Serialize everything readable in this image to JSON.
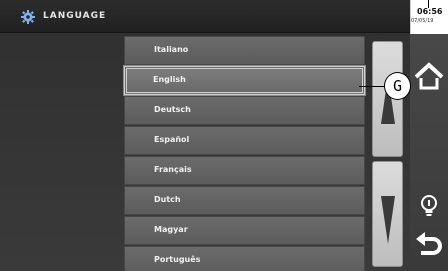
{
  "header": {
    "title": "LANGUAGE"
  },
  "languages": [
    {
      "label": "Italiano"
    },
    {
      "label": "English"
    },
    {
      "label": "Deutsch"
    },
    {
      "label": "Español"
    },
    {
      "label": "Français"
    },
    {
      "label": "Dutch"
    },
    {
      "label": "Magyar"
    },
    {
      "label": "Português"
    }
  ],
  "selected_language": "English",
  "clock": {
    "time": "06:56",
    "date": "07/05/19"
  },
  "callout": {
    "label": "G"
  },
  "icons": {
    "settings": "gear-icon",
    "scroll_up": "triangle-up-icon",
    "scroll_down": "triangle-down-icon",
    "home": "home-icon",
    "info": "lightbulb-icon",
    "back": "back-arrow-icon"
  },
  "colors": {
    "panel_bg": "#333333",
    "item_bg": "#636363",
    "item_text": "#f2f2f2",
    "scroll_bg": "#cccccc",
    "rail_bg": "#444444",
    "gear_accent": "#4a90d9"
  }
}
